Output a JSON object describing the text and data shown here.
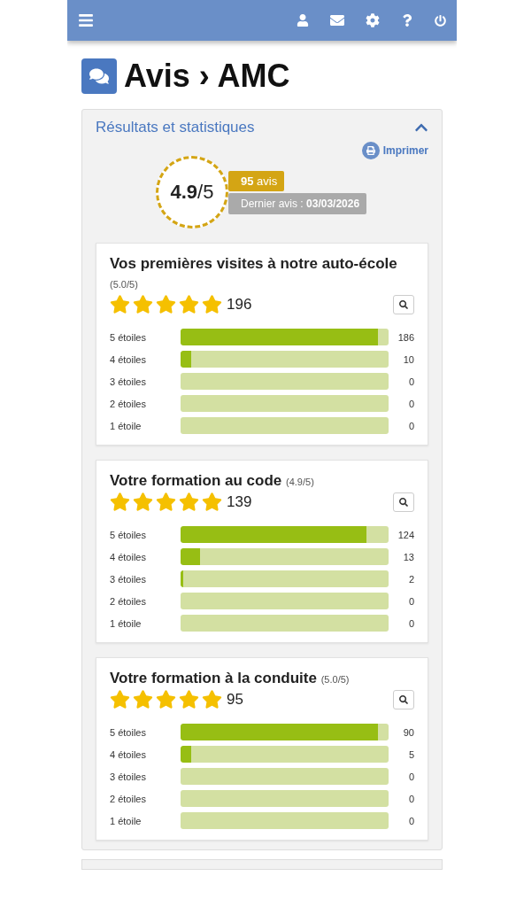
{
  "page_title": {
    "section": "Avis",
    "separator": "›",
    "name": "AMC"
  },
  "panel": {
    "title": "Résultats et statistiques",
    "expanded": true,
    "print_label": "Imprimer",
    "score": {
      "value": "4.9",
      "max": "/5"
    },
    "reviews_badge": "**95** avis",
    "last_review": "Dernier avis : **03/03/2026**"
  },
  "cards": [
    {
      "title": "Vos premières visites à notre auto-école",
      "rating": "(5.0/5)",
      "stars": 5,
      "total": "196",
      "rows": [
        {
          "label": "5 étoiles",
          "count": "186",
          "level": 0.949
        },
        {
          "label": "4 étoiles",
          "count": "10",
          "level": 0.051
        },
        {
          "label": "3 étoiles",
          "count": "0"
        },
        {
          "label": "2 étoiles",
          "count": "0"
        },
        {
          "label": "1 étoile",
          "count": "0"
        }
      ]
    },
    {
      "title": "Votre formation au code",
      "rating": "(4.9/5)",
      "stars": 5,
      "total": "139",
      "rows": [
        {
          "label": "5 étoiles",
          "count": "124",
          "level": 0.892
        },
        {
          "label": "4 étoiles",
          "count": "13",
          "level": 0.094
        },
        {
          "label": "3 étoiles",
          "count": "2",
          "level": 0.014
        },
        {
          "label": "2 étoiles",
          "count": "0"
        },
        {
          "label": "1 étoile",
          "count": "0"
        }
      ]
    },
    {
      "title": "Votre formation à la conduite",
      "rating": "(5.0/5)",
      "stars": 5,
      "total": "95",
      "rows": [
        {
          "label": "5 étoiles",
          "count": "90",
          "level": 0.947
        },
        {
          "label": "4 étoiles",
          "count": "5",
          "level": 0.053
        },
        {
          "label": "3 étoiles",
          "count": "0"
        },
        {
          "label": "2 étoiles",
          "count": "0"
        },
        {
          "label": "1 étoile",
          "count": "0"
        }
      ]
    }
  ]
}
